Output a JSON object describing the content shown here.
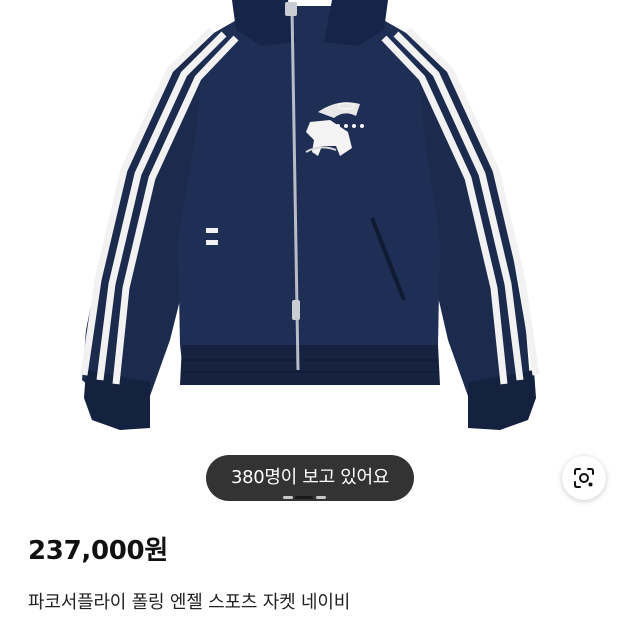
{
  "product": {
    "viewers_text": "380명이 보고 있어요",
    "price": "237,000원",
    "title": "파코서플라이 폴링 엔젤 스포츠 자켓 네이비",
    "image_pages": {
      "total": 3,
      "current": 2
    }
  },
  "icons": {
    "image_search": "image-search-lens-icon"
  },
  "colors": {
    "jacket_navy": "#1c2a4d",
    "stripe_white": "#f2f2f2",
    "viewer_pill_bg": "#333333",
    "indicator_active": "#1a1a1a",
    "indicator_inactive": "#c8c8c8"
  }
}
